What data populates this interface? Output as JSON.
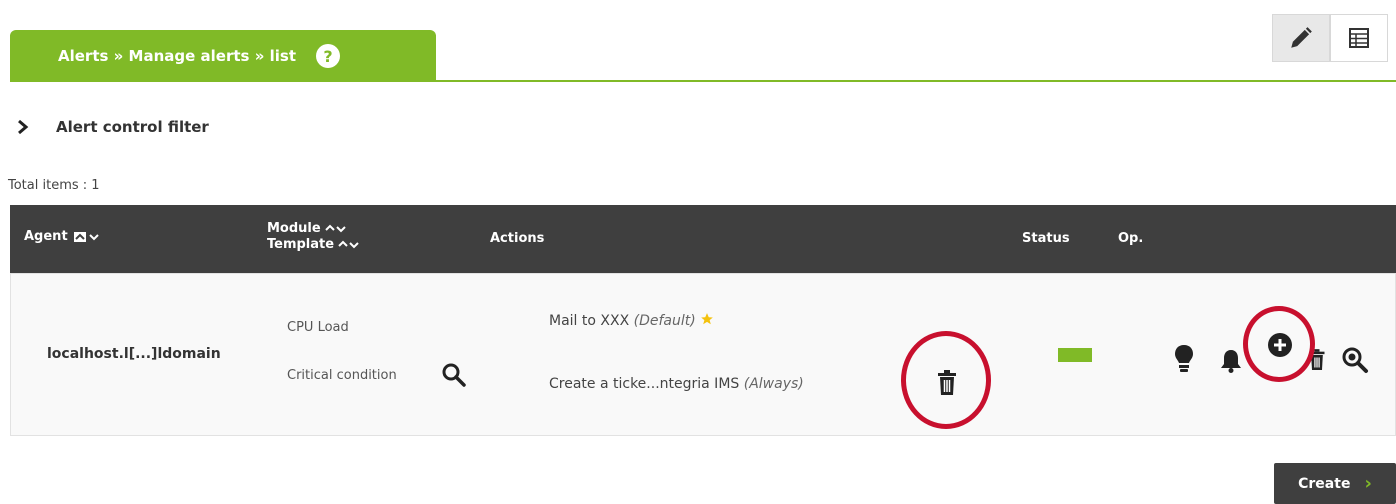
{
  "breadcrumb": {
    "title": "Alerts » Manage alerts » list",
    "help_glyph": "?"
  },
  "view_buttons": [
    {
      "icon": "pencil-icon",
      "active": false
    },
    {
      "icon": "table-icon",
      "active": true
    }
  ],
  "filter": {
    "label": "Alert control filter",
    "expand_glyph": "›"
  },
  "total_items": "Total items : 1",
  "table": {
    "headers": {
      "agent": "Agent",
      "module": "Module",
      "template": "Template",
      "actions": "Actions",
      "status": "Status",
      "op": "Op."
    },
    "rows": [
      {
        "agent": "localhost.l[...]ldomain",
        "module": "CPU Load",
        "template": "Critical condition",
        "actions": [
          {
            "name": "Mail to XXX",
            "qualifier": "(Default)"
          },
          {
            "name": "Create a ticke...ntegria IMS",
            "qualifier": "(Always)"
          }
        ],
        "status_color": "#80ba27"
      }
    ]
  },
  "create_button": {
    "label": "Create",
    "arrow": "›"
  },
  "colors": {
    "accent": "#80ba27",
    "header_bg": "#3f3f3f",
    "highlight_circle": "#c8102e"
  }
}
